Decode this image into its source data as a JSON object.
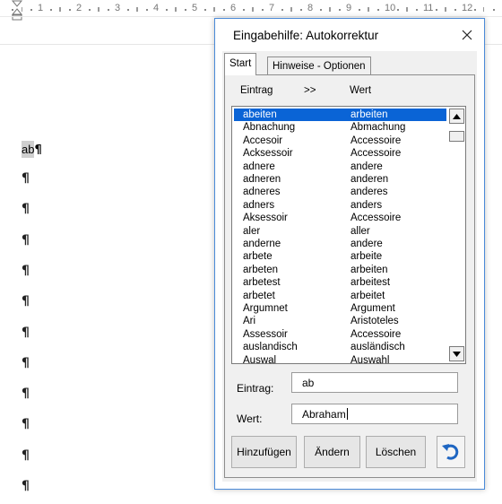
{
  "ruler": {
    "numbers": [
      "1",
      "2",
      "3",
      "4",
      "5",
      "6",
      "7",
      "8",
      "9",
      "10",
      "11",
      "12"
    ]
  },
  "document": {
    "selected_text": "ab",
    "pilcrow": "¶"
  },
  "dialog": {
    "title": "Eingabehilfe: Autokorrektur",
    "tabs": [
      {
        "label": "Start"
      },
      {
        "label": "Hinweise - Optionen"
      }
    ],
    "list": {
      "header_entry": "Eintrag",
      "header_sep": ">>",
      "header_value": "Wert",
      "rows": [
        {
          "entry": "abeiten",
          "value": "arbeiten"
        },
        {
          "entry": "Abnachung",
          "value": "Abmachung"
        },
        {
          "entry": "Accesoir",
          "value": "Accessoire"
        },
        {
          "entry": "Acksessoir",
          "value": "Accessoire"
        },
        {
          "entry": "adnere",
          "value": "andere"
        },
        {
          "entry": "adneren",
          "value": "anderen"
        },
        {
          "entry": "adneres",
          "value": "anderes"
        },
        {
          "entry": "adners",
          "value": "anders"
        },
        {
          "entry": "Aksessoir",
          "value": "Accessoire"
        },
        {
          "entry": "aler",
          "value": "aller"
        },
        {
          "entry": "anderne",
          "value": "andere"
        },
        {
          "entry": "arbete",
          "value": "arbeite"
        },
        {
          "entry": "arbeten",
          "value": "arbeiten"
        },
        {
          "entry": "arbetest",
          "value": "arbeitest"
        },
        {
          "entry": "arbetet",
          "value": "arbeitet"
        },
        {
          "entry": "Argumnet",
          "value": "Argument"
        },
        {
          "entry": "Ari",
          "value": "Aristoteles"
        },
        {
          "entry": "Assessoir",
          "value": "Accessoire"
        },
        {
          "entry": "auslandisch",
          "value": "ausländisch"
        },
        {
          "entry": "Auswal",
          "value": "Auswahl"
        }
      ]
    },
    "entry_label": "Eintrag:",
    "entry_value": "ab",
    "value_label": "Wert:",
    "value_value": "Abraham",
    "buttons": {
      "add": "Hinzufügen",
      "change": "Ändern",
      "delete": "Löschen"
    },
    "colors": {
      "selection": "#0a64d6",
      "border": "#4a8ad8"
    }
  }
}
